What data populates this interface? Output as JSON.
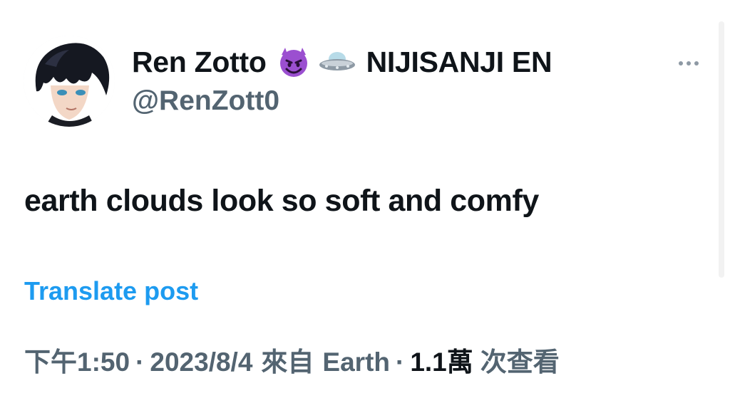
{
  "tweet": {
    "display_name": "Ren Zotto",
    "affiliation": "NIJISANJI EN",
    "handle": "@RenZott0",
    "text": "earth clouds look so soft and comfy",
    "translate_label": "Translate post",
    "time": "下午1:50",
    "date": "2023/8/4",
    "source_prefix": "來自",
    "source": "Earth",
    "views_count": "1.1萬",
    "views_label": "次查看",
    "separator": "·"
  },
  "icons": {
    "emoji_1": "smiling-devil-icon",
    "emoji_2": "ufo-icon",
    "more": "more-options-icon"
  },
  "colors": {
    "text": "#0f1419",
    "secondary_text": "#536471",
    "link": "#1d9bf0",
    "background": "#ffffff"
  }
}
